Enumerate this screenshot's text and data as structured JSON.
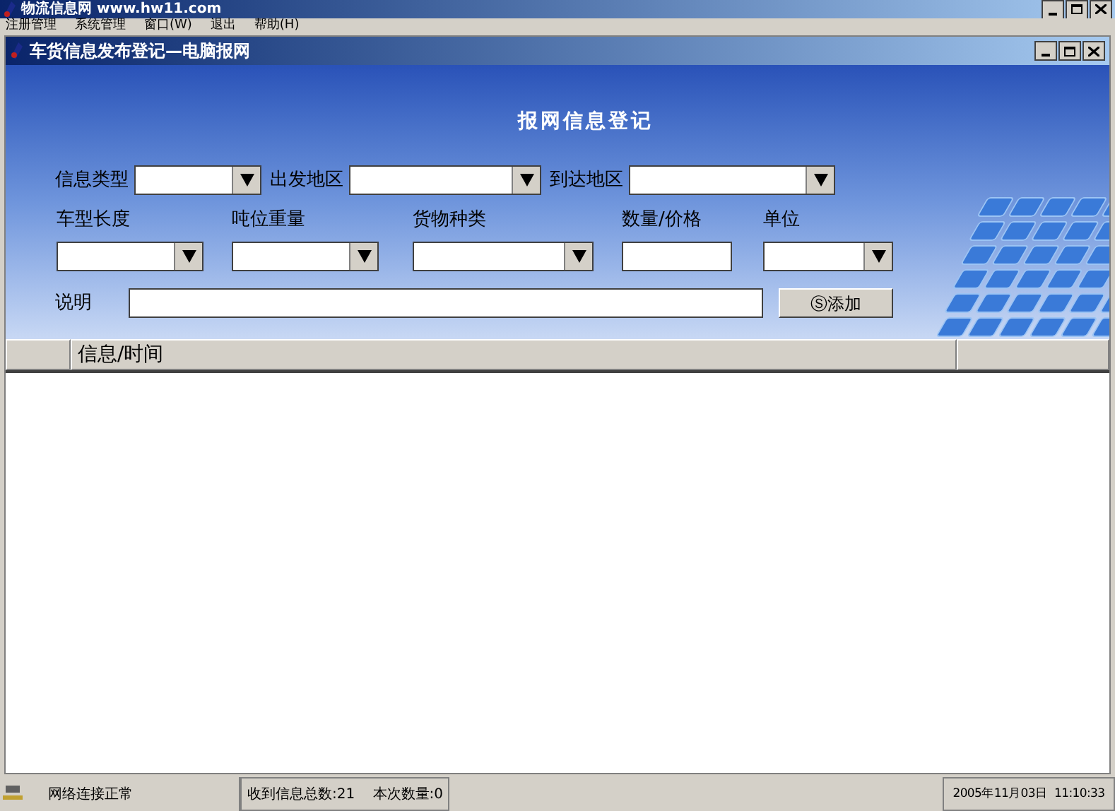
{
  "app_window": {
    "title": "物流信息网 www.hw11.com"
  },
  "menu": [
    "注册管理",
    "系统管理",
    "窗口(W)",
    "退出",
    "帮助(H)"
  ],
  "child_window": {
    "title": "车货信息发布登记—电脑报网"
  },
  "form": {
    "heading": "报网信息登记",
    "row_1": [
      {
        "label": "信息类型",
        "kind": "combo"
      },
      {
        "label": "出发地区",
        "kind": "combo"
      },
      {
        "label": "到达地区",
        "kind": "combo"
      }
    ],
    "row_2": [
      {
        "label": "车型长度",
        "kind": "combo"
      },
      {
        "label": "吨位重量",
        "kind": "combo"
      },
      {
        "label": "货物种类",
        "kind": "combo"
      },
      {
        "label": "数量/价格",
        "kind": "text"
      },
      {
        "label": "单位",
        "kind": "combo"
      }
    ],
    "description": {
      "label": "说明"
    },
    "add_button": "Ⓢ添加"
  },
  "table": {
    "columns": [
      "信息/时间"
    ]
  },
  "status_bar": [
    "网络连接正常",
    "收到信息总数:21    本次数量:0",
    "2005年11月03日  11:10:33"
  ]
}
